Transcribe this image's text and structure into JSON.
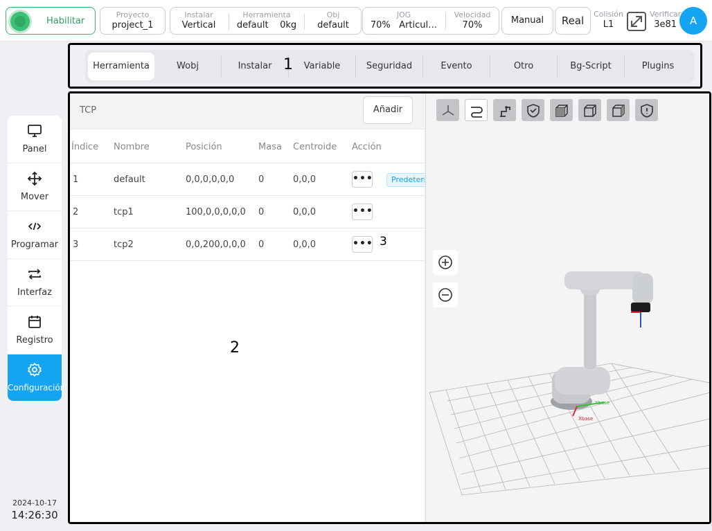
{
  "topbar": {
    "enable_label": "Habilitar",
    "project": {
      "label": "Proyecto",
      "value": "project_1"
    },
    "install": {
      "label": "Instalar",
      "value": "Vertical"
    },
    "tool": {
      "label": "Herramienta",
      "value": "default",
      "mass": "0kg"
    },
    "obj": {
      "label": "Obj",
      "value": "default"
    },
    "jog": {
      "label": "JOG",
      "value": "70%",
      "mode": "Articul…"
    },
    "speed": {
      "label": "Velocidad",
      "value": "70%"
    },
    "manual_label": "Manual",
    "real_label": "Real",
    "collision": {
      "label": "Colisión",
      "value": "L1"
    },
    "verify": {
      "label": "Verificar",
      "value": "3e81"
    },
    "avatar_letter": "A"
  },
  "sidebar": {
    "items": [
      {
        "label": "Panel",
        "icon": "monitor-icon"
      },
      {
        "label": "Mover",
        "icon": "move-icon"
      },
      {
        "label": "Programar",
        "icon": "code-icon"
      },
      {
        "label": "Interfaz",
        "icon": "exchange-icon"
      },
      {
        "label": "Registro",
        "icon": "calendar-icon"
      },
      {
        "label": "Configuración",
        "icon": "gear-icon",
        "active": true
      }
    ],
    "date": "2024-10-17",
    "time": "14:26:30"
  },
  "tabs": {
    "items": [
      "Herramienta",
      "Wobj",
      "Instalar",
      "Variable",
      "Seguridad",
      "Evento",
      "Otro",
      "Bg-Script",
      "Plugins"
    ],
    "active": "Herramienta"
  },
  "annotations": {
    "tabs_marker": "1",
    "panel_marker": "2",
    "action_marker": "3"
  },
  "tcp_panel": {
    "title": "TCP",
    "add_label": "Añadir",
    "columns": [
      "Índice",
      "Nombre",
      "Posición",
      "Masa",
      "Centroide",
      "Acción"
    ],
    "rows": [
      {
        "index": "1",
        "name": "default",
        "position": "0,0,0,0,0,0",
        "mass": "0",
        "centroid": "0,0,0",
        "action": "•••",
        "badge": "Predeterminado"
      },
      {
        "index": "2",
        "name": "tcp1",
        "position": "100,0,0,0,0,0",
        "mass": "0",
        "centroid": "0,0,0",
        "action": "•••"
      },
      {
        "index": "3",
        "name": "tcp2",
        "position": "0,0,200,0,0,0",
        "mass": "0",
        "centroid": "0,0,0",
        "action": "•••"
      }
    ]
  },
  "view3d": {
    "toolbar_icons": [
      "axes-icon",
      "path-icon",
      "robot-icon",
      "shield-check-icon",
      "cube-front-icon",
      "cube-outline-icon",
      "cube-side-icon",
      "shield-alert-icon"
    ],
    "axis_labels": {
      "x": "Xbase",
      "y": "Ybase"
    },
    "colors": {
      "accent": "#15a4f1",
      "enable": "#3fbf77",
      "robot": "#c8cacd",
      "tool": "#1a1a1a"
    }
  }
}
